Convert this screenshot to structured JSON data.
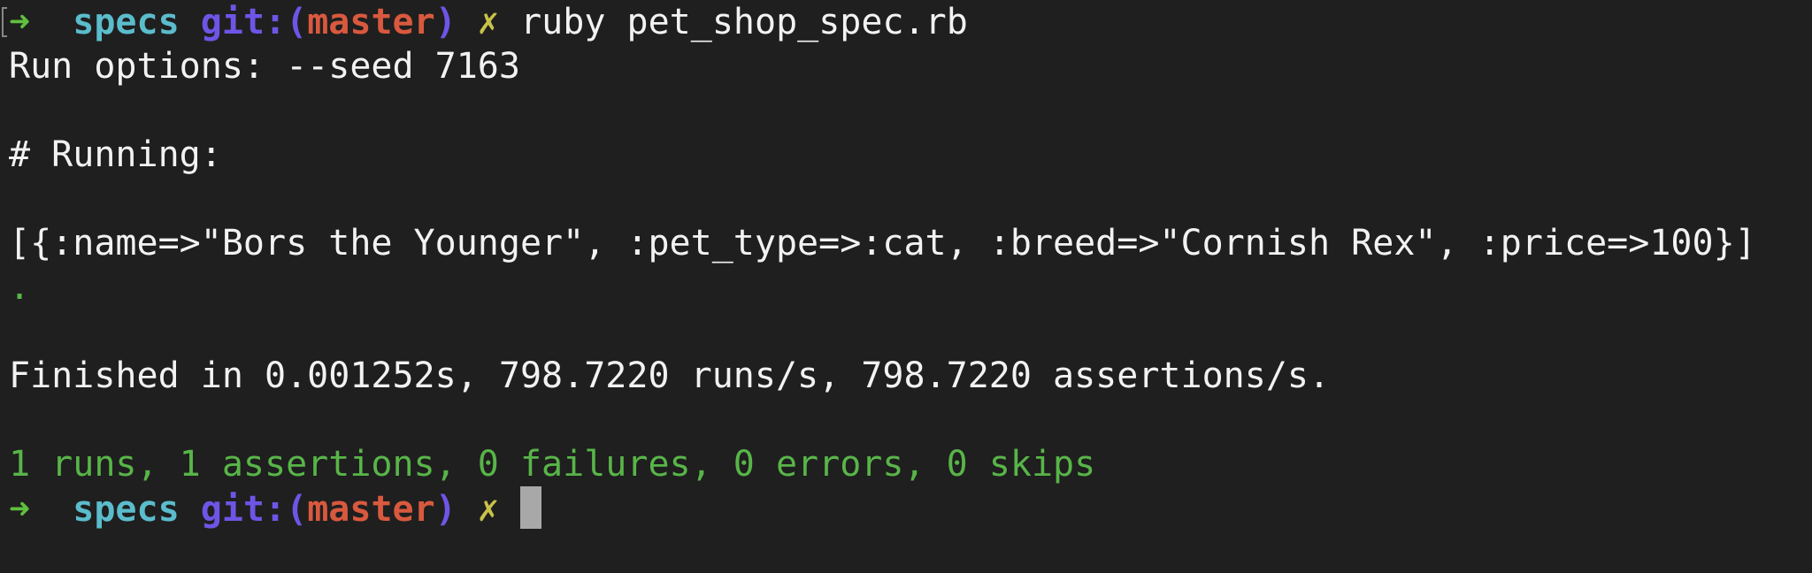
{
  "window": {
    "title": ""
  },
  "colors": {
    "background": "#1f1f1f",
    "text": "#f2f2f2",
    "arrow": "#5fbf3f",
    "directory": "#5bbccc",
    "git": "#6f55e6",
    "branch": "#d9593e",
    "dirty_marker": "#c9c24a",
    "success": "#58b548",
    "cursor": "#a8a8a8"
  },
  "prompt1": {
    "arrow": "➜",
    "directory": "specs",
    "git_label": "git:(",
    "branch": "master",
    "git_close": ")",
    "dirty": "✗",
    "command": "ruby pet_shop_spec.rb"
  },
  "output": {
    "run_options": "Run options: --seed 7163",
    "running_header": "# Running:",
    "data_dump": "[{:name=>\"Bors the Younger\", :pet_type=>:cat, :breed=>\"Cornish Rex\", :price=>100}]",
    "progress_dot": ".",
    "finished": "Finished in 0.001252s, 798.7220 runs/s, 798.7220 assertions/s.",
    "summary": "1 runs, 1 assertions, 0 failures, 0 errors, 0 skips"
  },
  "prompt2": {
    "arrow": "➜",
    "directory": "specs",
    "git_label": "git:(",
    "branch": "master",
    "git_close": ")",
    "dirty": "✗"
  }
}
